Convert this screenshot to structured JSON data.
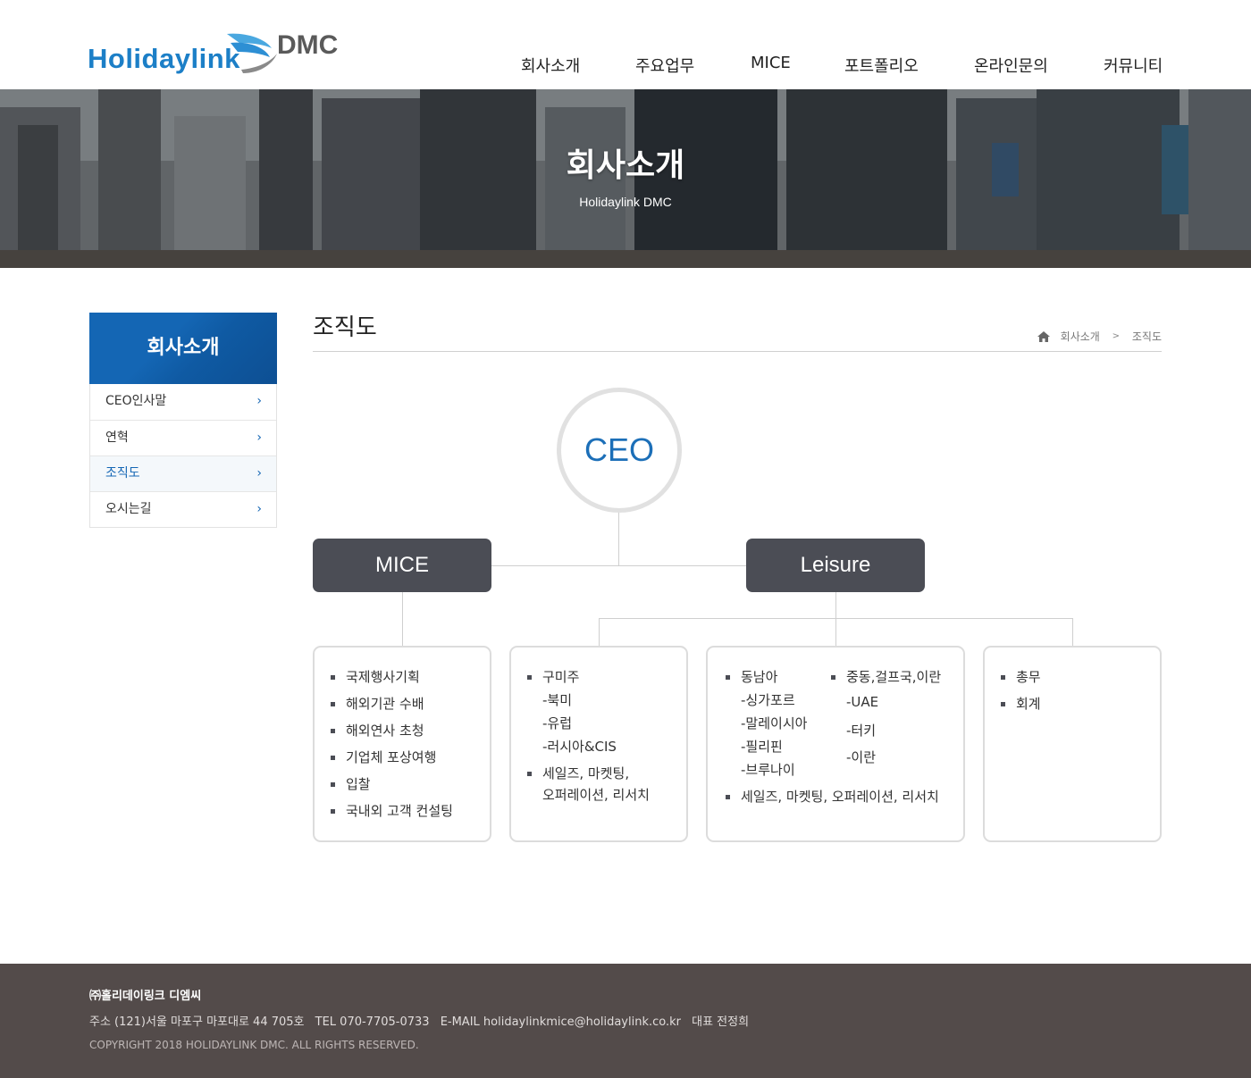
{
  "header": {
    "logo_main": "Holidaylink",
    "logo_sub": "DMC",
    "nav": [
      "회사소개",
      "주요업무",
      "MICE",
      "포트폴리오",
      "온라인문의",
      "커뮤니티"
    ]
  },
  "banner": {
    "title": "회사소개",
    "subtitle": "Holidaylink DMC"
  },
  "sidebar": {
    "title": "회사소개",
    "items": [
      {
        "label": "CEO인사말",
        "active": false
      },
      {
        "label": "연혁",
        "active": false
      },
      {
        "label": "조직도",
        "active": true
      },
      {
        "label": "오시는길",
        "active": false
      }
    ]
  },
  "content": {
    "title": "조직도",
    "breadcrumb": [
      "회사소개",
      "조직도"
    ]
  },
  "org": {
    "ceo": "CEO",
    "departments": [
      "MICE",
      "Leisure"
    ],
    "box1": [
      "국제행사기획",
      "해외기관 수배",
      "해외연사 초청",
      "기업체 포상여행",
      "입찰",
      "국내외 고객 컨설팅"
    ],
    "box2": {
      "b1": "구미주",
      "b1_subs": [
        "-북미",
        "-유럽",
        "-러시아&CIS"
      ],
      "b2_line1": "세일즈, 마켓팅,",
      "b2_line2": "오퍼레이션, 리서치"
    },
    "box3": {
      "b1": "동남아",
      "b1_subs": [
        "-싱가포르",
        "-말레이시아",
        "-필리핀",
        "-브루나이"
      ],
      "b2": "중동,걸프국,이란",
      "b2_subs": [
        "-UAE",
        "-터키",
        "-이란"
      ],
      "b3": "세일즈, 마켓팅, 오퍼레이션, 리서치"
    },
    "box4": [
      "총무",
      "회계"
    ]
  },
  "footer": {
    "company": "㈜홀리데이링크 디엠씨",
    "address": "주소 (121)서울 마포구 마포대로 44 705호",
    "tel": "TEL 070-7705-0733",
    "email": "E-MAIL holidaylinkmice@holidaylink.co.kr",
    "ceo": "대표 전정희",
    "copyright": "COPYRIGHT 2018 HOLIDAYLINK DMC. ALL RIGHTS RESERVED."
  }
}
